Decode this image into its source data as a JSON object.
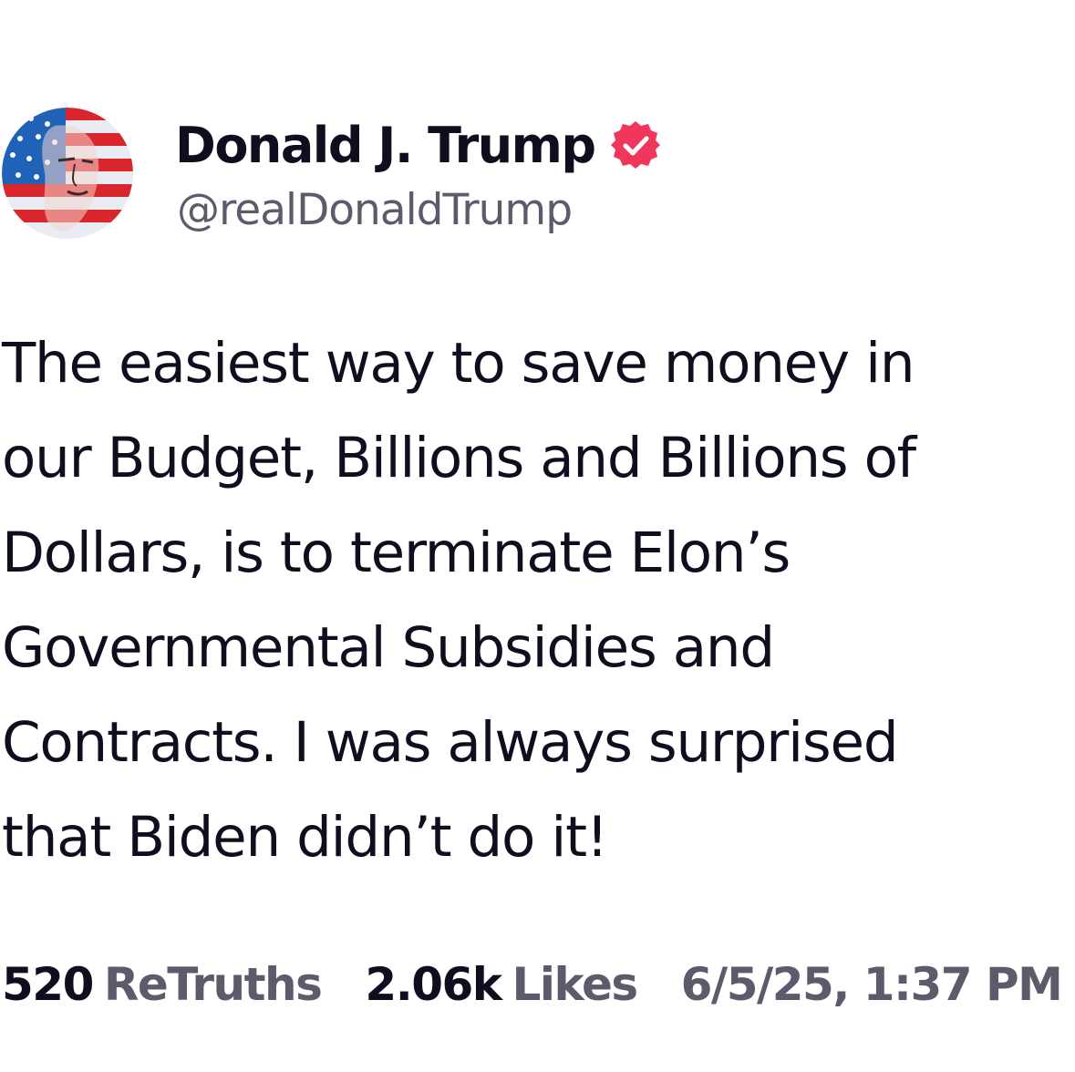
{
  "post": {
    "author": {
      "display_name": "Donald J. Trump",
      "handle": "@realDonaldTrump",
      "verified_icon": "verified-badge-icon",
      "verified_color": "#f0365b",
      "avatar_icon": "flag-portrait-avatar"
    },
    "body_lines": [
      "The easiest way to save money in",
      "our Budget, Billions and Billions of",
      "Dollars, is to terminate Elon’s",
      "Governmental Subsidies and",
      "Contracts. I was always surprised",
      "that Biden didn’t do it!"
    ],
    "stats": {
      "retruths_count": "520",
      "retruths_label": "ReTruths",
      "likes_count": "2.06k",
      "likes_label": "Likes",
      "timestamp": "6/5/25, 1:37 PM"
    }
  },
  "colors": {
    "text_primary": "#0f0e1f",
    "text_secondary": "#5c5b6c",
    "background": "#ffffff"
  }
}
